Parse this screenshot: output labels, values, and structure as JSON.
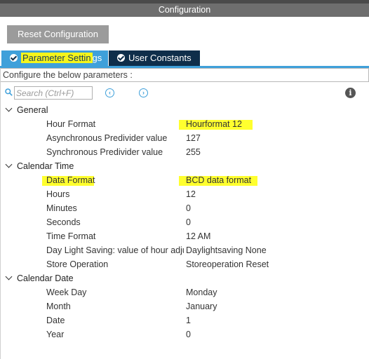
{
  "window": {
    "title": "Configuration"
  },
  "toolbar": {
    "reset_label": "Reset Configuration"
  },
  "tabs": [
    {
      "label_highlighted": "Parameter Settin",
      "label_rest": "gs",
      "active": true
    },
    {
      "label": "User Constants",
      "active": false
    }
  ],
  "configure_text": "Configure the below parameters :",
  "search": {
    "placeholder": "Search (Ctrl+F)",
    "value": ""
  },
  "icons": {
    "search": "search-icon",
    "prev": "arrow-left-circle-icon",
    "next": "arrow-right-circle-icon",
    "info": "info-icon",
    "check": "check-circle-icon",
    "chevron": "chevron-down-icon"
  },
  "colors": {
    "title_bar": "#6e6e6e",
    "accent_tab": "#3fa0da",
    "dark_tab": "#0f2e4a",
    "highlight": "#ffff2e"
  },
  "groups": [
    {
      "label": "General",
      "rows": [
        {
          "key": "Hour Format",
          "value": "Hourformat 12"
        },
        {
          "key": "Asynchronous Predivider value",
          "value": "127"
        },
        {
          "key": "Synchronous Predivider value",
          "value": "255"
        }
      ]
    },
    {
      "label": "Calendar Time",
      "rows": [
        {
          "key": "Data Format",
          "value": "BCD data format"
        },
        {
          "key": "Hours",
          "value": "12"
        },
        {
          "key": "Minutes",
          "value": "0"
        },
        {
          "key": "Seconds",
          "value": "0"
        },
        {
          "key": "Time Format",
          "value": "12 AM"
        },
        {
          "key": "Day Light Saving: value of hour adjustment",
          "value": "Daylightsaving None"
        },
        {
          "key": "Store Operation",
          "value": "Storeoperation Reset"
        }
      ]
    },
    {
      "label": "Calendar Date",
      "rows": [
        {
          "key": "Week Day",
          "value": "Monday"
        },
        {
          "key": "Month",
          "value": "January"
        },
        {
          "key": "Date",
          "value": "1"
        },
        {
          "key": "Year",
          "value": "0"
        }
      ]
    }
  ]
}
